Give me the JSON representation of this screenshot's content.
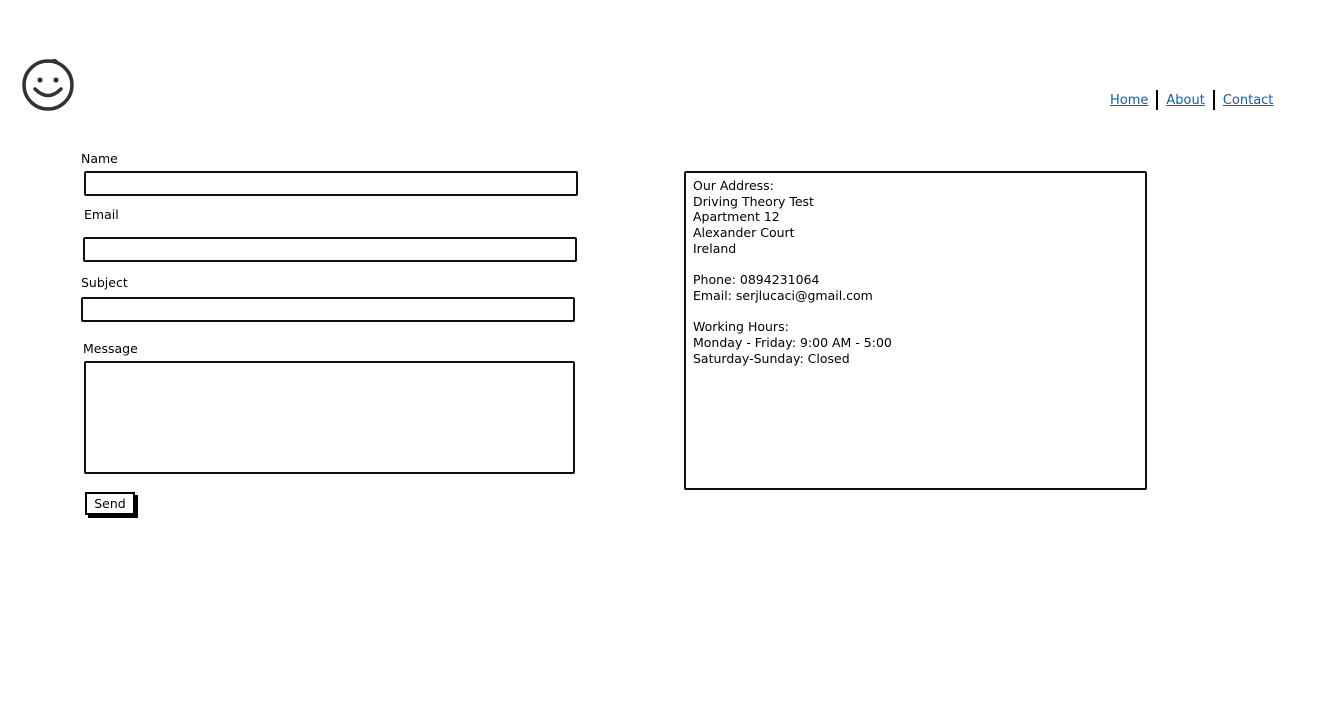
{
  "logo": {
    "icon": "smiley-face-icon"
  },
  "nav": {
    "items": [
      "Home",
      "About",
      "Contact"
    ],
    "link_color": "#1a5aa0"
  },
  "form": {
    "name_label": "Name",
    "email_label": "Email",
    "subject_label": "Subject",
    "message_label": "Message",
    "name_value": "",
    "email_value": "",
    "subject_value": "",
    "message_value": "",
    "send_label": "Send"
  },
  "info": {
    "address_heading": "Our Address:",
    "address_lines": [
      "Driving Theory Test",
      "Apartment 12",
      "Alexander Court",
      "Ireland"
    ],
    "phone": "Phone: 0894231064",
    "email": "Email: serjlucaci@gmail.com",
    "hours_heading": "Working Hours:",
    "hours_lines": [
      "Monday - Friday: 9:00 AM - 5:00",
      "Saturday-Sunday: Closed"
    ]
  }
}
